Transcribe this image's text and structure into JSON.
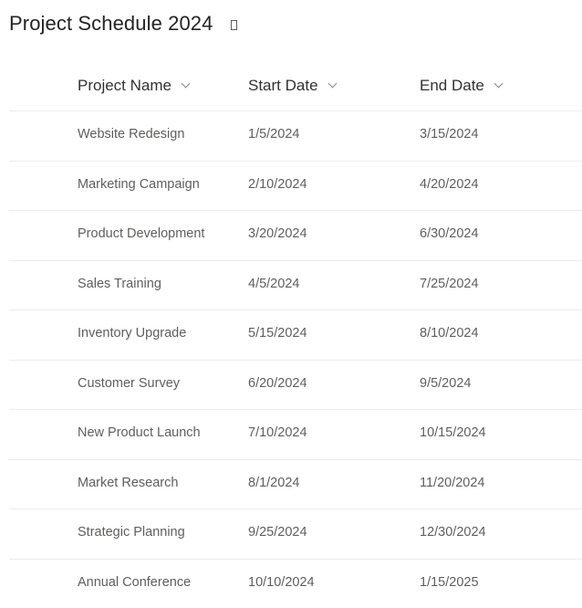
{
  "page": {
    "title": "Project Schedule 2024",
    "title_icon": "square-outline-icon"
  },
  "table": {
    "columns": [
      {
        "label": "Project Name",
        "icon": "chevron-down-icon"
      },
      {
        "label": "Start Date",
        "icon": "chevron-down-icon"
      },
      {
        "label": "End Date",
        "icon": "chevron-down-icon"
      }
    ],
    "rows": [
      {
        "name": "Website Redesign",
        "start": "1/5/2024",
        "end": "3/15/2024"
      },
      {
        "name": "Marketing Campaign",
        "start": "2/10/2024",
        "end": "4/20/2024"
      },
      {
        "name": "Product Development",
        "start": "3/20/2024",
        "end": "6/30/2024"
      },
      {
        "name": "Sales Training",
        "start": "4/5/2024",
        "end": "7/25/2024"
      },
      {
        "name": "Inventory Upgrade",
        "start": "5/15/2024",
        "end": "8/10/2024"
      },
      {
        "name": "Customer Survey",
        "start": "6/20/2024",
        "end": "9/5/2024"
      },
      {
        "name": "New Product Launch",
        "start": "7/10/2024",
        "end": "10/15/2024"
      },
      {
        "name": "Market Research",
        "start": "8/1/2024",
        "end": "11/20/2024"
      },
      {
        "name": "Strategic Planning",
        "start": "9/25/2024",
        "end": "12/30/2024"
      },
      {
        "name": "Annual Conference",
        "start": "10/10/2024",
        "end": "1/15/2025"
      }
    ]
  }
}
